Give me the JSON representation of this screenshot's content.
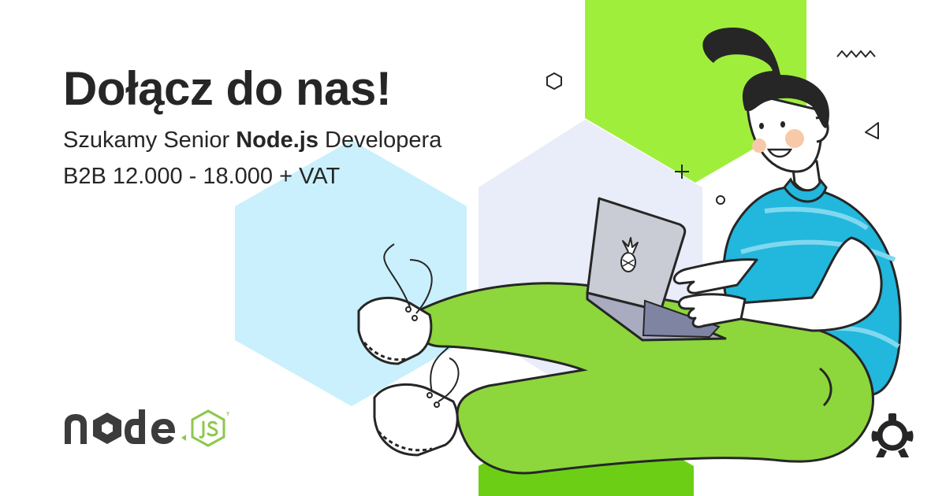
{
  "banner": {
    "headline": "Dołącz do nas!",
    "subheading": {
      "prefix": "Szukamy Senior ",
      "highlight": "Node.js",
      "suffix": " Developera"
    },
    "salary": "B2B 12.000 - 18.000 + VAT"
  },
  "illustration": {
    "laptop_icon": "pineapple-icon",
    "brand_logo": "node-js-logo",
    "company_logo_icon": "robot-head-icon"
  },
  "colors": {
    "text": "#262626",
    "lime_green": "#8dd63c",
    "hex_green": "#a0ee3c",
    "hex_dark_green": "#6ccf15",
    "sweater_blue": "#22b7dd",
    "hex_light_blue": "#c9f0fc",
    "hex_lavender": "#e9ecf9",
    "laptop_gray": "#c9ccd4",
    "node_green": "#8cc84b"
  }
}
